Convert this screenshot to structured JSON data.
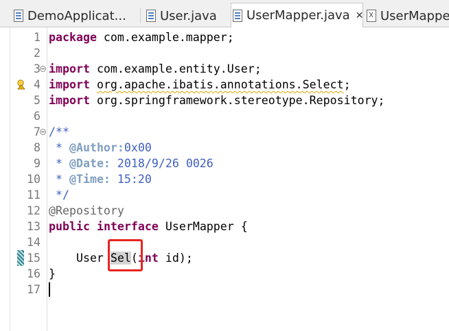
{
  "tabs": [
    {
      "label": "DemoApplicat...",
      "icon": "java-file-icon",
      "active": false
    },
    {
      "label": "User.java",
      "icon": "java-file-icon",
      "active": false
    },
    {
      "label": "UserMapper.java",
      "icon": "java-file-icon",
      "active": true
    },
    {
      "label": "UserMapper",
      "icon": "xml-file-icon",
      "active": false
    }
  ],
  "editor": {
    "line_numbers": [
      "1",
      "2",
      "3",
      "4",
      "5",
      "6",
      "7",
      "8",
      "9",
      "10",
      "11",
      "12",
      "13",
      "14",
      "15",
      "16",
      "17"
    ],
    "code": {
      "l1_kw": "package",
      "l1_rest": " com.example.mapper;",
      "l3_kw": "import",
      "l3_rest": " com.example.entity.User;",
      "l4_kw": "import",
      "l4_rest": "org.apache.ibatis.annotations.Select",
      "l5_kw": "import",
      "l5_rest": " org.springframework.stereotype.Repository;",
      "l7": "/**",
      "l8_star": " * ",
      "l8_tag": "@Author:",
      "l8_val": "0x00",
      "l9_star": " * ",
      "l9_tag": "@Date:",
      "l9_val": " 2018/9/26 0026",
      "l10_star": " * ",
      "l10_tag": "@Time:",
      "l10_val": " 15:20",
      "l11": " */",
      "l12": "@Repository",
      "l13_kw1": "public",
      "l13_kw2": "interface",
      "l13_rest": " UserMapper {",
      "l15_pre": "    User ",
      "l15_word": "Sel",
      "l15_paren": "(",
      "l15_kw": "int",
      "l15_rest": " id);",
      "l16": "}"
    }
  },
  "colors": {
    "keyword": "#7f0055",
    "comment": "#3f5fbf",
    "javadoc_tag": "#7f9fbf",
    "annotation": "#646464",
    "highlight_box": "#e8231f"
  }
}
